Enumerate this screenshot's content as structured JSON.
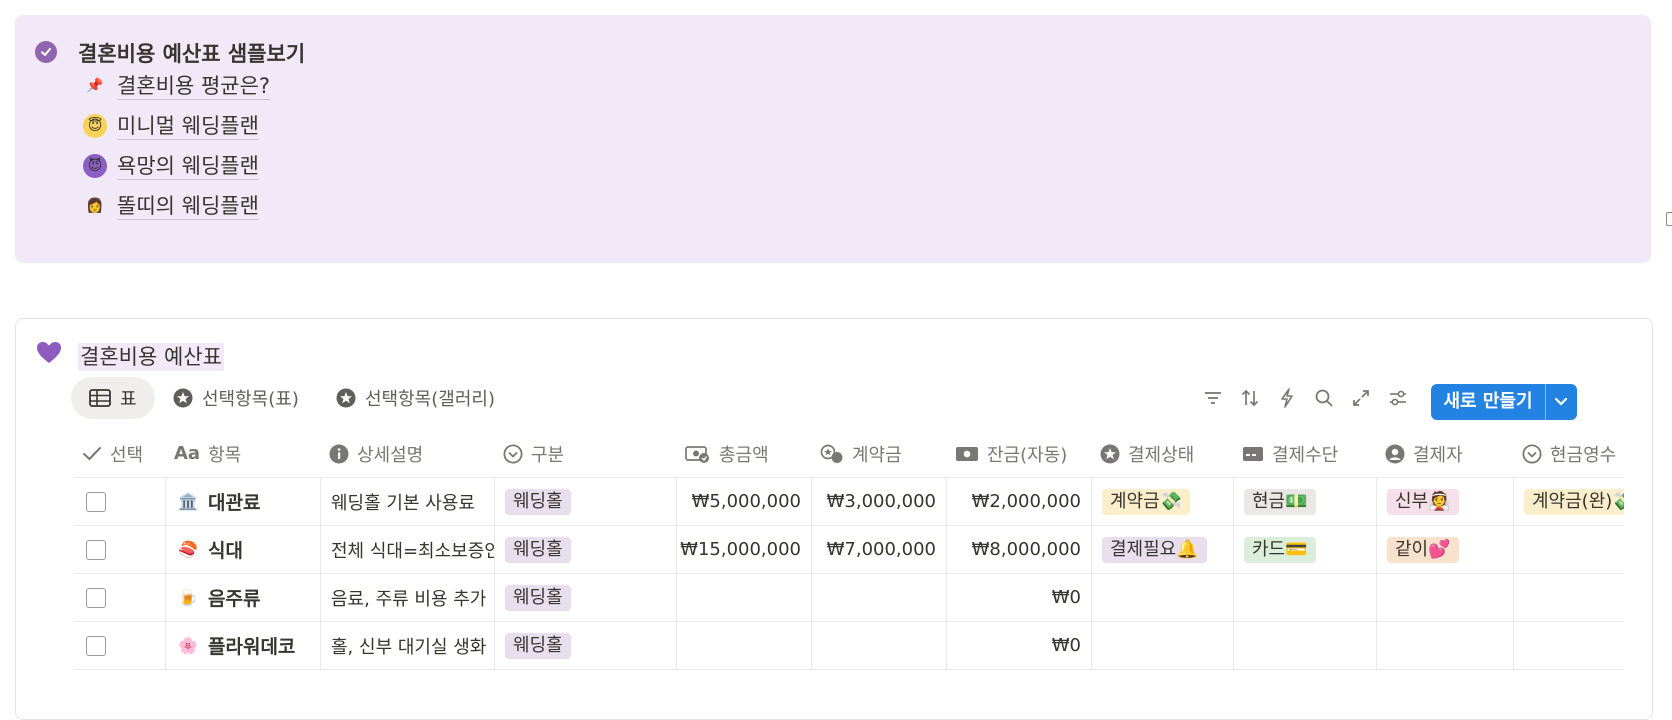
{
  "callout": {
    "title": "결혼비용 예산표 샘플보기",
    "links": [
      {
        "emoji": "📌",
        "label": "결혼비용 평균은?"
      },
      {
        "emoji": "😇",
        "label": "미니멀 웨딩플랜"
      },
      {
        "emoji": "😈",
        "label": "욕망의 웨딩플랜"
      },
      {
        "emoji": "👩",
        "label": "똘띠의 웨딩플랜"
      }
    ]
  },
  "database": {
    "title": "결혼비용 예산표",
    "views": [
      {
        "label": "표",
        "icon": "table-icon"
      },
      {
        "label": "선택항목(표)",
        "icon": "star-circle-icon"
      },
      {
        "label": "선택항목(갤러리)",
        "icon": "star-circle-icon"
      }
    ],
    "toolbar_icons": [
      "filter-icon",
      "sort-icon",
      "automation-bolt-icon",
      "search-icon",
      "expand-icon",
      "settings-sliders-icon"
    ],
    "new_button": "새로 만들기"
  },
  "columns": [
    {
      "label": "선택",
      "icon": "checkmark-icon"
    },
    {
      "label": "항목",
      "icon": "text-aa-icon"
    },
    {
      "label": "상세설명",
      "icon": "info-icon"
    },
    {
      "label": "구분",
      "icon": "select-icon"
    },
    {
      "label": "총금액",
      "icon": "money-icon"
    },
    {
      "label": "계약금",
      "icon": "coins-icon"
    },
    {
      "label": "잔금(자동)",
      "icon": "bill-icon"
    },
    {
      "label": "결제상태",
      "icon": "star-circle-icon"
    },
    {
      "label": "결제수단",
      "icon": "card-icon"
    },
    {
      "label": "결제자",
      "icon": "person-icon"
    },
    {
      "label": "현금영수",
      "icon": "select-icon"
    }
  ],
  "rows": [
    {
      "emoji": "🏛️",
      "name": "대관료",
      "desc": "웨딩홀 기본 사용료",
      "category": "웨딩홀",
      "total": "₩5,000,000",
      "deposit": "₩3,000,000",
      "balance": "₩2,000,000",
      "status": "계약금💸",
      "method": "현금💵",
      "payer": "신부👰",
      "receipt": "계약금(완)💸"
    },
    {
      "emoji": "🍣",
      "name": "식대",
      "desc": "전체 식대=최소보증인원",
      "category": "웨딩홀",
      "total": "₩15,000,000",
      "deposit": "₩7,000,000",
      "balance": "₩8,000,000",
      "status": "결제필요🔔",
      "method": "카드💳",
      "payer": "같이💕",
      "receipt": ""
    },
    {
      "emoji": "🍺",
      "name": "음주류",
      "desc": "음료, 주류 비용 추가",
      "category": "웨딩홀",
      "total": "",
      "deposit": "",
      "balance": "₩0",
      "status": "",
      "method": "",
      "payer": "",
      "receipt": ""
    },
    {
      "emoji": "🌸",
      "name": "플라워데코",
      "desc": "홀, 신부 대기실 생화",
      "category": "웨딩홀",
      "total": "",
      "deposit": "",
      "balance": "₩0",
      "status": "",
      "method": "",
      "payer": "",
      "receipt": ""
    }
  ],
  "colors": {
    "callout_bg": "#f2e9f8",
    "accent_purple": "#9065b0",
    "primary_button": "#2383e2",
    "tag_purple": "#e8deee",
    "tag_yellow": "#fbeecb",
    "tag_gray": "#e9e8e6",
    "tag_green": "#dbeddb",
    "tag_pink": "#f5e0e9",
    "tag_orange": "#f9e2cd"
  }
}
